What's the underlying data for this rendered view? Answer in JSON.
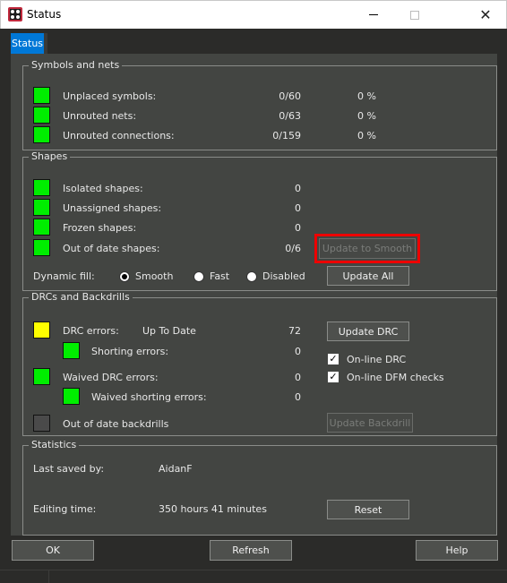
{
  "window": {
    "title": "Status",
    "icons": {
      "app": "app-logo-icon",
      "minimize": "minimize-icon",
      "maximize": "maximize-icon",
      "close": "close-icon"
    },
    "close_glyph": "✕"
  },
  "tabs": [
    {
      "label": "Status",
      "active": true
    }
  ],
  "symbols_and_nets": {
    "title": "Symbols and nets",
    "rows": [
      {
        "label": "Unplaced symbols:",
        "value": "0/60",
        "percent": "0 %",
        "status": "green"
      },
      {
        "label": "Unrouted nets:",
        "value": "0/63",
        "percent": "0 %",
        "status": "green"
      },
      {
        "label": "Unrouted connections:",
        "value": "0/159",
        "percent": "0 %",
        "status": "green"
      }
    ]
  },
  "shapes": {
    "title": "Shapes",
    "rows": [
      {
        "label": "Isolated shapes:",
        "value": "0",
        "status": "green"
      },
      {
        "label": "Unassigned shapes:",
        "value": "0",
        "status": "green"
      },
      {
        "label": "Frozen shapes:",
        "value": "0",
        "status": "green"
      },
      {
        "label": "Out of date shapes:",
        "value": "0/6",
        "status": "green"
      }
    ],
    "update_to_smooth_label": "Update to Smooth",
    "update_all_label": "Update All",
    "dynamic_fill": {
      "label": "Dynamic fill:",
      "options": [
        "Smooth",
        "Fast",
        "Disabled"
      ],
      "selected": "Smooth"
    }
  },
  "drcs": {
    "title": "DRCs and Backdrills",
    "drc_errors": {
      "label": "DRC errors:",
      "state": "Up To Date",
      "value": "72",
      "status": "yellow"
    },
    "shorting_errors": {
      "label": "Shorting errors:",
      "value": "0",
      "status": "green"
    },
    "waived_drc_errors": {
      "label": "Waived DRC errors:",
      "value": "0",
      "status": "green"
    },
    "waived_shorting_errors": {
      "label": "Waived shorting errors:",
      "value": "0",
      "status": "green"
    },
    "out_of_date_backdrills": {
      "label": "Out of date backdrills",
      "status": "gray"
    },
    "update_drc_label": "Update DRC",
    "update_backdrill_label": "Update Backdrill",
    "online_drc": {
      "label": "On-line DRC",
      "checked": true
    },
    "online_dfm": {
      "label": "On-line DFM checks",
      "checked": true
    },
    "check_glyph": "✓"
  },
  "statistics": {
    "title": "Statistics",
    "last_saved_by_label": "Last saved by:",
    "last_saved_by_value": "AidanF",
    "editing_time_label": "Editing time:",
    "editing_time_value": "350 hours 41 minutes",
    "reset_label": "Reset"
  },
  "footer": {
    "ok_label": "OK",
    "refresh_label": "Refresh",
    "help_label": "Help"
  },
  "colors": {
    "status_green": "#00ee00",
    "status_yellow": "#ffff00",
    "status_gray": "#4a4a4a",
    "tab_active": "#0078d7",
    "highlight": "#ee0000"
  }
}
